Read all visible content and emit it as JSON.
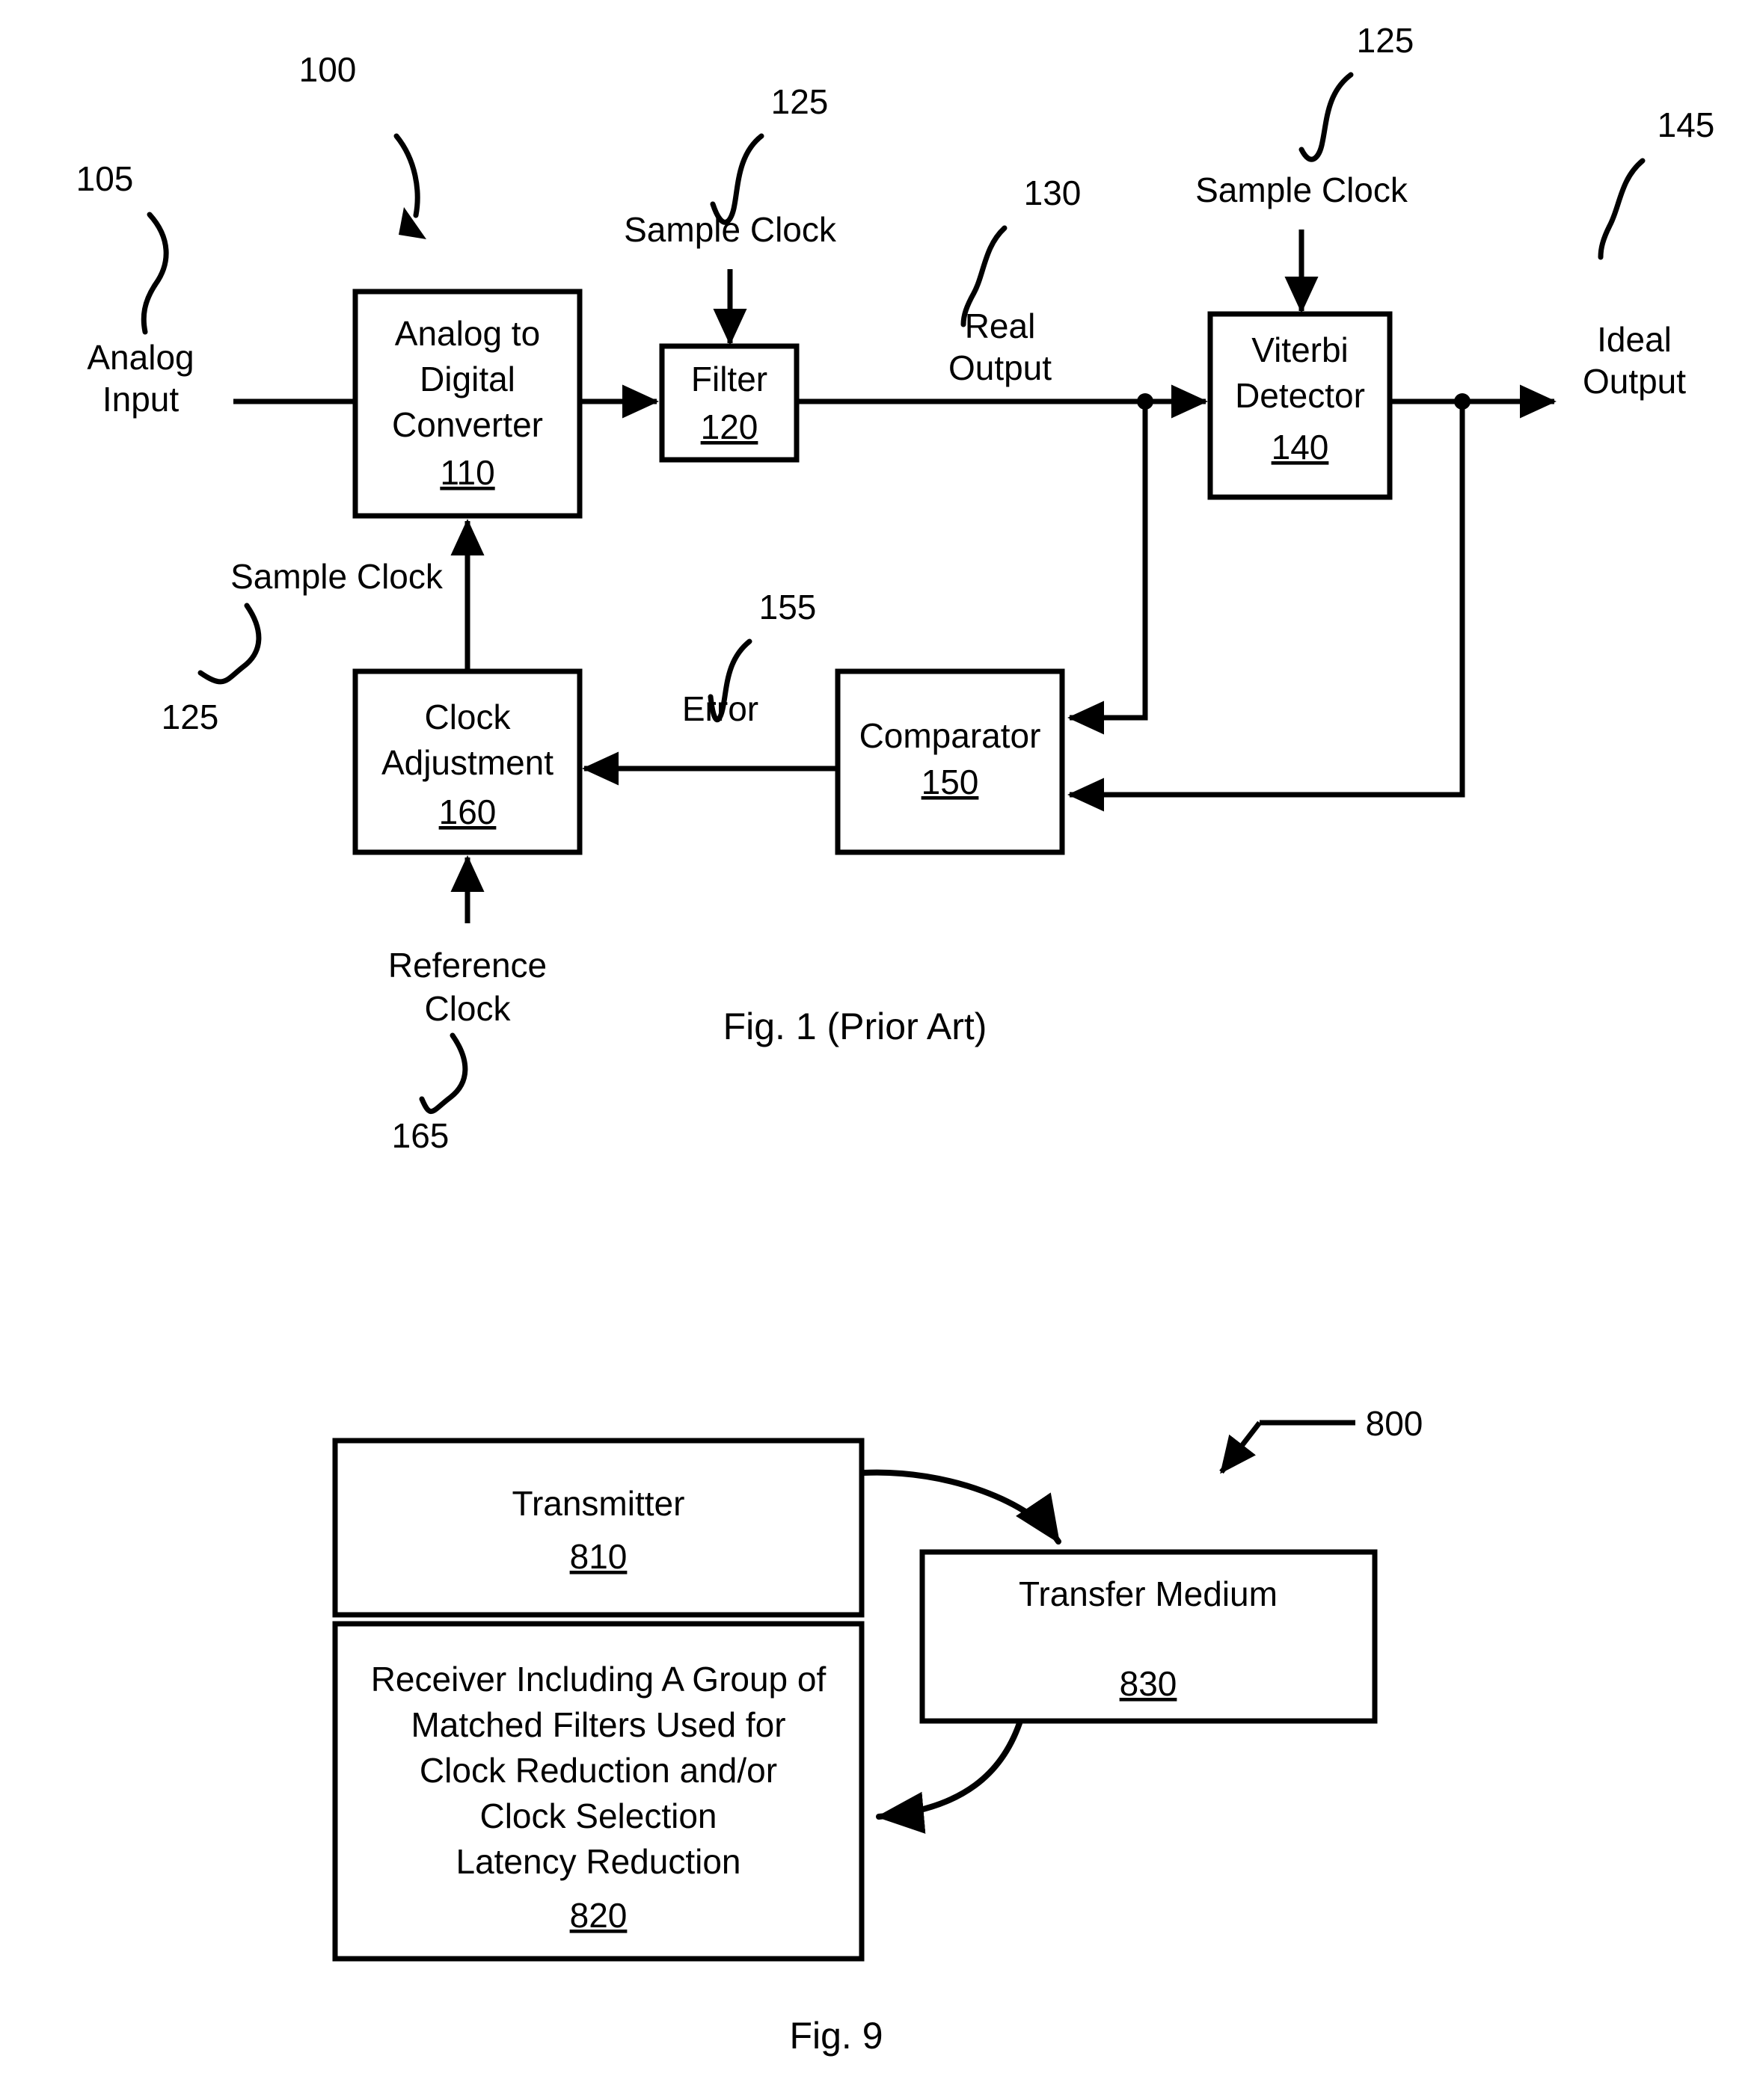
{
  "document": {
    "type": "patent-drawing-sheet",
    "figures": [
      "Fig. 1 (Prior Art)",
      "Fig. 9"
    ]
  },
  "figure1": {
    "caption": "Fig. 1 (Prior Art)",
    "system_ref": "100",
    "blocks": [
      {
        "id": "adc",
        "title_line1": "Analog to",
        "title_line2": "Digital",
        "title_line3": "Converter",
        "ref": "110"
      },
      {
        "id": "filter",
        "title_line1": "Filter",
        "ref": "120"
      },
      {
        "id": "viterbi",
        "title_line1": "Viterbi",
        "title_line2": "Detector",
        "ref": "140"
      },
      {
        "id": "comparator",
        "title_line1": "Comparator",
        "ref": "150"
      },
      {
        "id": "clockadj",
        "title_line1": "Clock",
        "title_line2": "Adjustment",
        "ref": "160"
      }
    ],
    "signals": {
      "analog_input_line1": "Analog",
      "analog_input_line2": "Input",
      "analog_input_ref": "105",
      "sample_clock_adc": "Sample Clock",
      "sample_clock_adc_ref": "125",
      "sample_clock_filter": "Sample Clock",
      "sample_clock_filter_ref": "125",
      "sample_clock_viterbi": "Sample Clock",
      "sample_clock_viterbi_ref": "125",
      "real_output_line1": "Real",
      "real_output_line2": "Output",
      "real_output_ref": "130",
      "ideal_output_line1": "Ideal",
      "ideal_output_line2": "Output",
      "ideal_output_ref": "145",
      "error": "Error",
      "error_ref": "155",
      "reference_clock_line1": "Reference",
      "reference_clock_line2": "Clock",
      "reference_clock_ref": "165"
    }
  },
  "figure9": {
    "caption": "Fig. 9",
    "system_ref": "800",
    "blocks": [
      {
        "id": "transmitter",
        "lines": [
          "Transmitter"
        ],
        "ref": "810"
      },
      {
        "id": "receiver",
        "lines": [
          "Receiver Including A Group of",
          "Matched Filters Used for",
          "Clock Reduction and/or",
          "Clock Selection",
          "Latency Reduction"
        ],
        "ref": "820"
      },
      {
        "id": "transfer-medium",
        "lines": [
          "Transfer Medium"
        ],
        "ref": "830"
      }
    ]
  },
  "style": {
    "ink": "#000000",
    "paper": "#ffffff"
  }
}
